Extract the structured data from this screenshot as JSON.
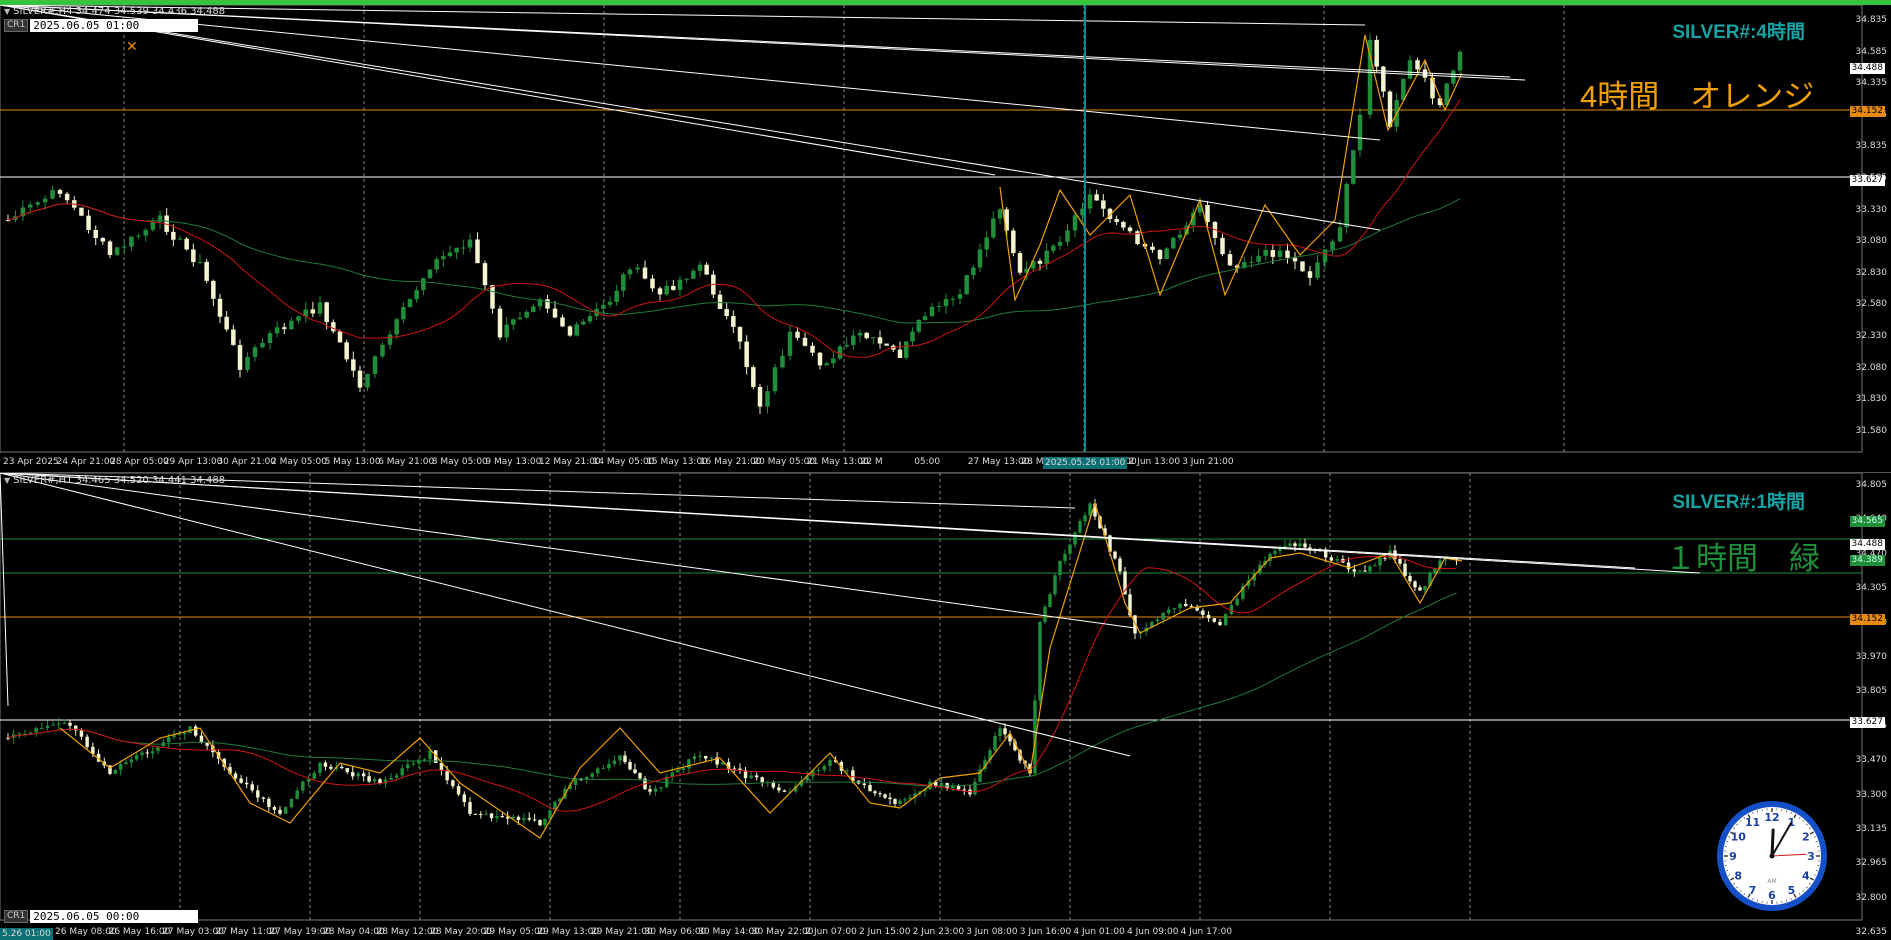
{
  "colors": {
    "background": "#000000",
    "bull": "#1f8f3a",
    "bear": "#f4f4d0",
    "ma_fast": "#d01414",
    "ma_slow": "#1f7a3a",
    "zigzag": "#f0a000",
    "orange_level": "#e88a10",
    "green_level": "#1f8f3a",
    "title": "#17a3a3"
  },
  "h4": {
    "header": "SILVER#,H4  34.474 34.539 34.436 34.488",
    "cr_label": "CR1",
    "datetime": "2025.06.05 01:00",
    "symbol_title": "SILVER#:4時間",
    "note": "4時間　オレンジ",
    "highlight_date": "2025.05.26 01:00",
    "price_axis": [
      "34.835",
      "34.585",
      "34.335",
      "34.085",
      "33.835",
      "33.585",
      "33.330",
      "33.080",
      "32.830",
      "32.580",
      "32.330",
      "32.080",
      "31.830",
      "31.580"
    ],
    "current_price": "34.488",
    "level_orange": "34.152",
    "level_white": "33.627",
    "time_axis": [
      "23 Apr 2025",
      "24 Apr 21:00",
      "28 Apr 05:00",
      "29 Apr 13:00",
      "30 Apr 21:00",
      "2 May 05:00",
      "5 May 13:00",
      "6 May 21:00",
      "8 May 05:00",
      "9 May 13:00",
      "12 May 21:00",
      "14 May 05:00",
      "15 May 13:00",
      "16 May 21:00",
      "20 May 05:00",
      "21 May 13:00",
      "22 M",
      "05:00",
      "27 May 13:00",
      "28 May 21:00",
      "30 May 05:00",
      "2 Jun 13:00",
      "3 Jun 21:00"
    ]
  },
  "h1": {
    "header": "SILVER#,H1  34.465 34.520 34.441 34.488",
    "cr_label": "CR1",
    "datetime": "2025.06.05 00:00",
    "symbol_title": "SILVER#:1時間",
    "note": "１時間　緑",
    "highlight_date": "5.26 01:00",
    "price_axis": [
      "34.805",
      "34.640",
      "34.470",
      "34.305",
      "34.140",
      "33.970",
      "33.805",
      "33.635",
      "33.470",
      "33.300",
      "33.135",
      "32.965",
      "32.800",
      "32.635"
    ],
    "current_price": "34.488",
    "level_green": "34.389",
    "level_green_top": "34.565",
    "level_orange": "34.152",
    "level_white": "33.627",
    "time_axis": [
      "26 May 08:00",
      "26 May 16:00",
      "27 May 03:00",
      "27 May 11:00",
      "27 May 19:00",
      "28 May 04:00",
      "28 May 12:00",
      "28 May 20:00",
      "29 May 05:00",
      "29 May 13:00",
      "29 May 21:00",
      "30 May 06:00",
      "30 May 14:00",
      "30 May 22:00",
      "2 Jun 07:00",
      "2 Jun 15:00",
      "2 Jun 23:00",
      "3 Jun 08:00",
      "3 Jun 16:00",
      "4 Jun 01:00",
      "4 Jun 09:00",
      "4 Jun 17:00"
    ]
  },
  "clock": {
    "numerals": [
      "12",
      "1",
      "2",
      "3",
      "4",
      "5",
      "6",
      "7",
      "8",
      "9",
      "10",
      "11"
    ],
    "brand": "AM",
    "hour": 12,
    "minute": 5,
    "second": 42
  }
}
